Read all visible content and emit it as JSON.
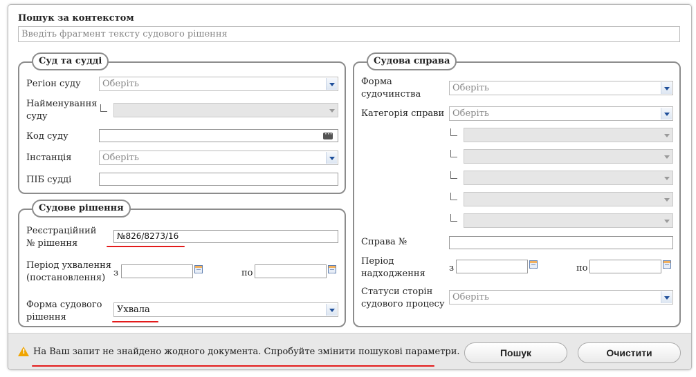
{
  "context_search": {
    "title": "Пошук за контекстом",
    "placeholder": "Введіть фрагмент тексту судового рішення"
  },
  "court_group": {
    "legend": "Суд та судді",
    "region_label": "Регіон суду",
    "region_value": "Оберіть",
    "name_label_1": "Найменування",
    "name_label_2": "суду",
    "code_label": "Код суду",
    "instance_label": "Інстанція",
    "instance_value": "Оберіть",
    "judge_label": "ПІБ судді"
  },
  "decision_group": {
    "legend": "Судове рішення",
    "reg_label_1": "Реєстраційний",
    "reg_label_2": "№ рішення",
    "reg_value": "№826/8273/16",
    "period_label_1": "Період ухвалення",
    "period_label_2": "(постановлення)",
    "from_label": "з",
    "to_label": "по",
    "form_label_1": "Форма судового",
    "form_label_2": "рішення",
    "form_value": "Ухвала"
  },
  "case_group": {
    "legend": "Судова справа",
    "proc_label_1": "Форма",
    "proc_label_2": "судочинства",
    "proc_value": "Оберіть",
    "category_label": "Категорія справи",
    "category_value": "Оберіть",
    "case_no_label": "Справа №",
    "period_label_1": "Період",
    "period_label_2": "надходження",
    "from_label": "з",
    "to_label": "по",
    "status_label_1": "Статуси сторін",
    "status_label_2": "судового процесу",
    "status_value": "Оберіть"
  },
  "footer": {
    "message": "На Ваш запит не знайдено жодного документа. Спробуйте змінити пошукові параметри.",
    "search_button": "Пошук",
    "clear_button": "Очистити"
  },
  "colors": {
    "annotation_underline": "#e31b1b",
    "warning": "#f0a500",
    "dropdown_arrow": "#1f4f9a"
  }
}
